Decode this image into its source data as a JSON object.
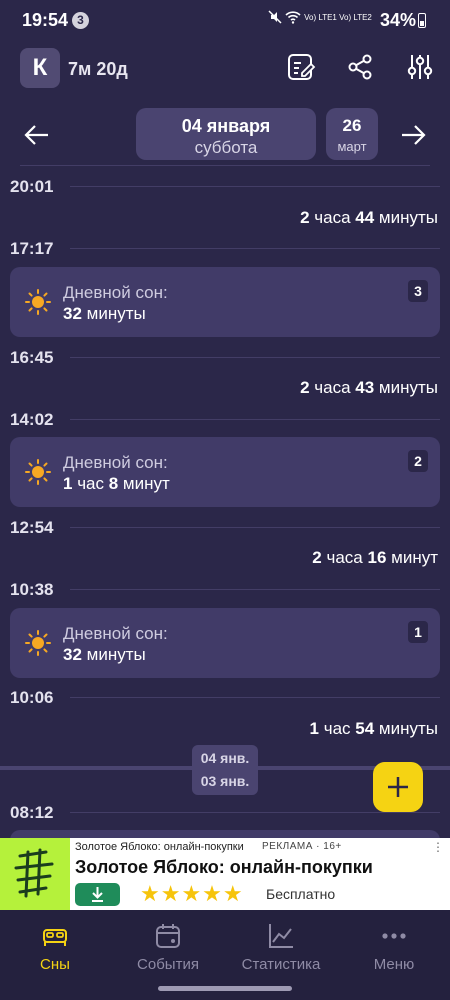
{
  "status_bar": {
    "time": "19:54",
    "notification_count": "3",
    "network": "Vo) LTE1 Vo) LTE2",
    "battery": "34%"
  },
  "header": {
    "avatar_letter": "К",
    "child_age": "7м 20д",
    "icons": [
      "notes-icon",
      "share-icon",
      "settings-sliders-icon"
    ]
  },
  "date_nav": {
    "current_date": "04 января",
    "current_weekday": "суббота",
    "alt_day": "26",
    "alt_month": "март"
  },
  "timeline": {
    "t1": "20:01",
    "d1_h": "2",
    "d1_hu": " часа ",
    "d1_m": "44",
    "d1_mu": " минуты",
    "t2": "17:17",
    "card1": {
      "title": "Дневной сон:",
      "value": "32",
      "unit": " минуты",
      "number": "3"
    },
    "t3": "16:45",
    "d2_h": "2",
    "d2_hu": " часа ",
    "d2_m": "43",
    "d2_mu": " минуты",
    "t4": "14:02",
    "card2": {
      "title": "Дневной сон:",
      "h": "1",
      "hu": " час ",
      "m": "8",
      "mu": " минут",
      "number": "2"
    },
    "t5": "12:54",
    "d3_h": "2",
    "d3_hu": " часа ",
    "d3_m": "16",
    "d3_mu": " минут",
    "t6": "10:38",
    "card3": {
      "title": "Дневной сон:",
      "value": "32",
      "unit": " минуты",
      "number": "1"
    },
    "t7": "10:06",
    "d4_h": "1",
    "d4_hu": " час ",
    "d4_m": "54",
    "d4_mu": " минуты",
    "day_from": "04 янв.",
    "day_to": "03 янв.",
    "t8": "08:12"
  },
  "ad": {
    "top_text": "Золотое Яблоко: онлайн-покупки",
    "tag": "РЕКЛАМА · 16+",
    "title": "Золотое Яблоко: онлайн-покупки",
    "stars": "★★★★★",
    "price": "Бесплатно",
    "more": "⋮"
  },
  "bottom_nav": {
    "tabs": [
      {
        "label": "Сны",
        "icon": "bed-icon",
        "active": true
      },
      {
        "label": "События",
        "icon": "calendar-icon",
        "active": false
      },
      {
        "label": "Статистика",
        "icon": "chart-icon",
        "active": false
      },
      {
        "label": "Меню",
        "icon": "more-dots-icon",
        "active": false
      }
    ]
  },
  "colors": {
    "background": "#2b2749",
    "card": "#413b68",
    "accent": "#f5d313",
    "sun": "#f7a823"
  }
}
